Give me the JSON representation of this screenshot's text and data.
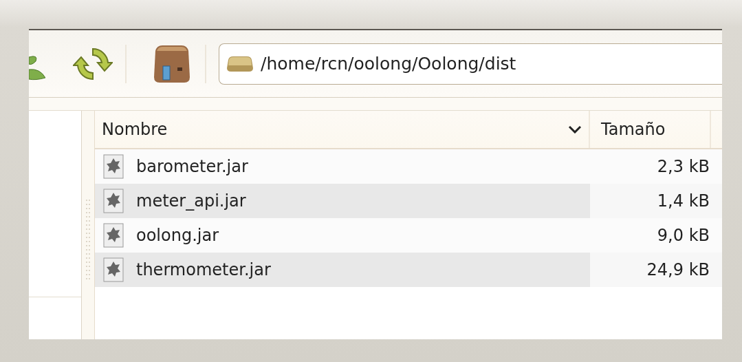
{
  "toolbar": {
    "location": "/home/rcn/oolong/Oolong/dist"
  },
  "file_list": {
    "columns": [
      {
        "label": "Nombre",
        "sorted": true
      },
      {
        "label": "Tamaño",
        "sorted": false
      }
    ],
    "rows": [
      {
        "name": "barometer.jar",
        "size": "2,3 kB"
      },
      {
        "name": "meter_api.jar",
        "size": "1,4 kB"
      },
      {
        "name": "oolong.jar",
        "size": "9,0 kB"
      },
      {
        "name": "thermometer.jar",
        "size": "24,9 kB"
      }
    ]
  }
}
